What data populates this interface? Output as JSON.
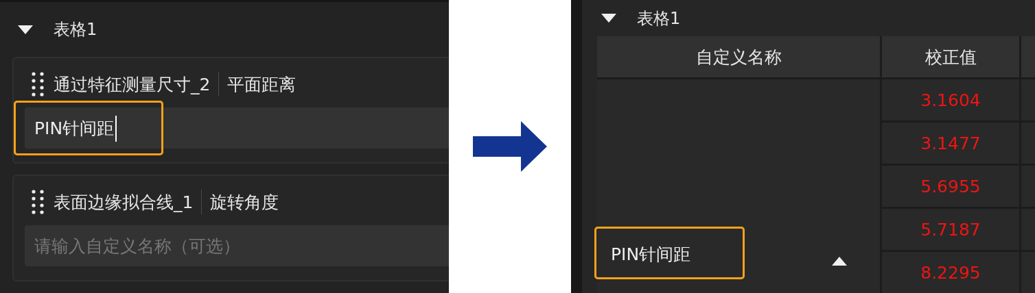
{
  "editor": {
    "section": {
      "title": "表格1",
      "expanded": true
    },
    "cards": [
      {
        "feature": "通过特征测量尺寸_2",
        "measure": "平面距离",
        "input": {
          "value": "PIN针间距",
          "focused": true,
          "highlighted": true
        }
      },
      {
        "feature": "表面边缘拟合线_1",
        "measure": "旋转角度",
        "input": {
          "placeholder": "请输入自定义名称（可选）",
          "focused": false,
          "highlighted": false
        }
      }
    ]
  },
  "result": {
    "section": {
      "title": "表格1",
      "expanded": true
    },
    "table": {
      "columns": [
        "自定义名称",
        "校正值"
      ],
      "name_cell": {
        "value": "PIN针间距",
        "highlighted": true,
        "sort_ascending": true
      },
      "rows": [
        {
          "value": "3.1604"
        },
        {
          "value": "3.1477"
        },
        {
          "value": "5.6955"
        },
        {
          "value": "5.7187"
        },
        {
          "value": "8.2295"
        }
      ]
    }
  }
}
